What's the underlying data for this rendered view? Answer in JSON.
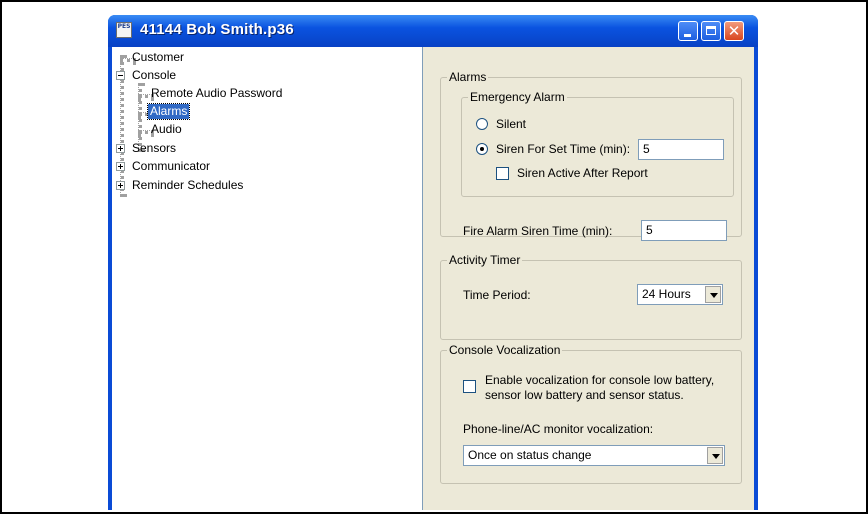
{
  "window": {
    "title": "41144 Bob Smith.p36",
    "icon_text": "PES"
  },
  "tree": {
    "items": [
      {
        "label": "Customer"
      },
      {
        "label": "Console"
      },
      {
        "label": "Remote Audio Password"
      },
      {
        "label": "Alarms",
        "selected": true
      },
      {
        "label": "Audio"
      },
      {
        "label": "Sensors"
      },
      {
        "label": "Communicator"
      },
      {
        "label": "Reminder Schedules"
      }
    ]
  },
  "alarms": {
    "group_label": "Alarms",
    "emergency": {
      "group_label": "Emergency Alarm",
      "silent_label": "Silent",
      "siren_label": "Siren For Set Time (min):",
      "siren_value": "5",
      "selected_option": "siren",
      "siren_active_label": "Siren Active After Report",
      "siren_active_checked": false
    },
    "fire_label": "Fire Alarm Siren Time (min):",
    "fire_value": "5"
  },
  "activity_timer": {
    "group_label": "Activity Timer",
    "period_label": "Time Period:",
    "period_value": "24 Hours"
  },
  "console_vocalization": {
    "group_label": "Console Vocalization",
    "enable_label_line1": "Enable vocalization for console low battery,",
    "enable_label_line2": "sensor low battery and sensor status.",
    "enable_checked": false,
    "phone_label": "Phone-line/AC monitor vocalization:",
    "phone_value": "Once on status change"
  },
  "colors": {
    "titlebar": "#0a53e0",
    "selection": "#316ac5",
    "panel_bg": "#ece9d8"
  }
}
